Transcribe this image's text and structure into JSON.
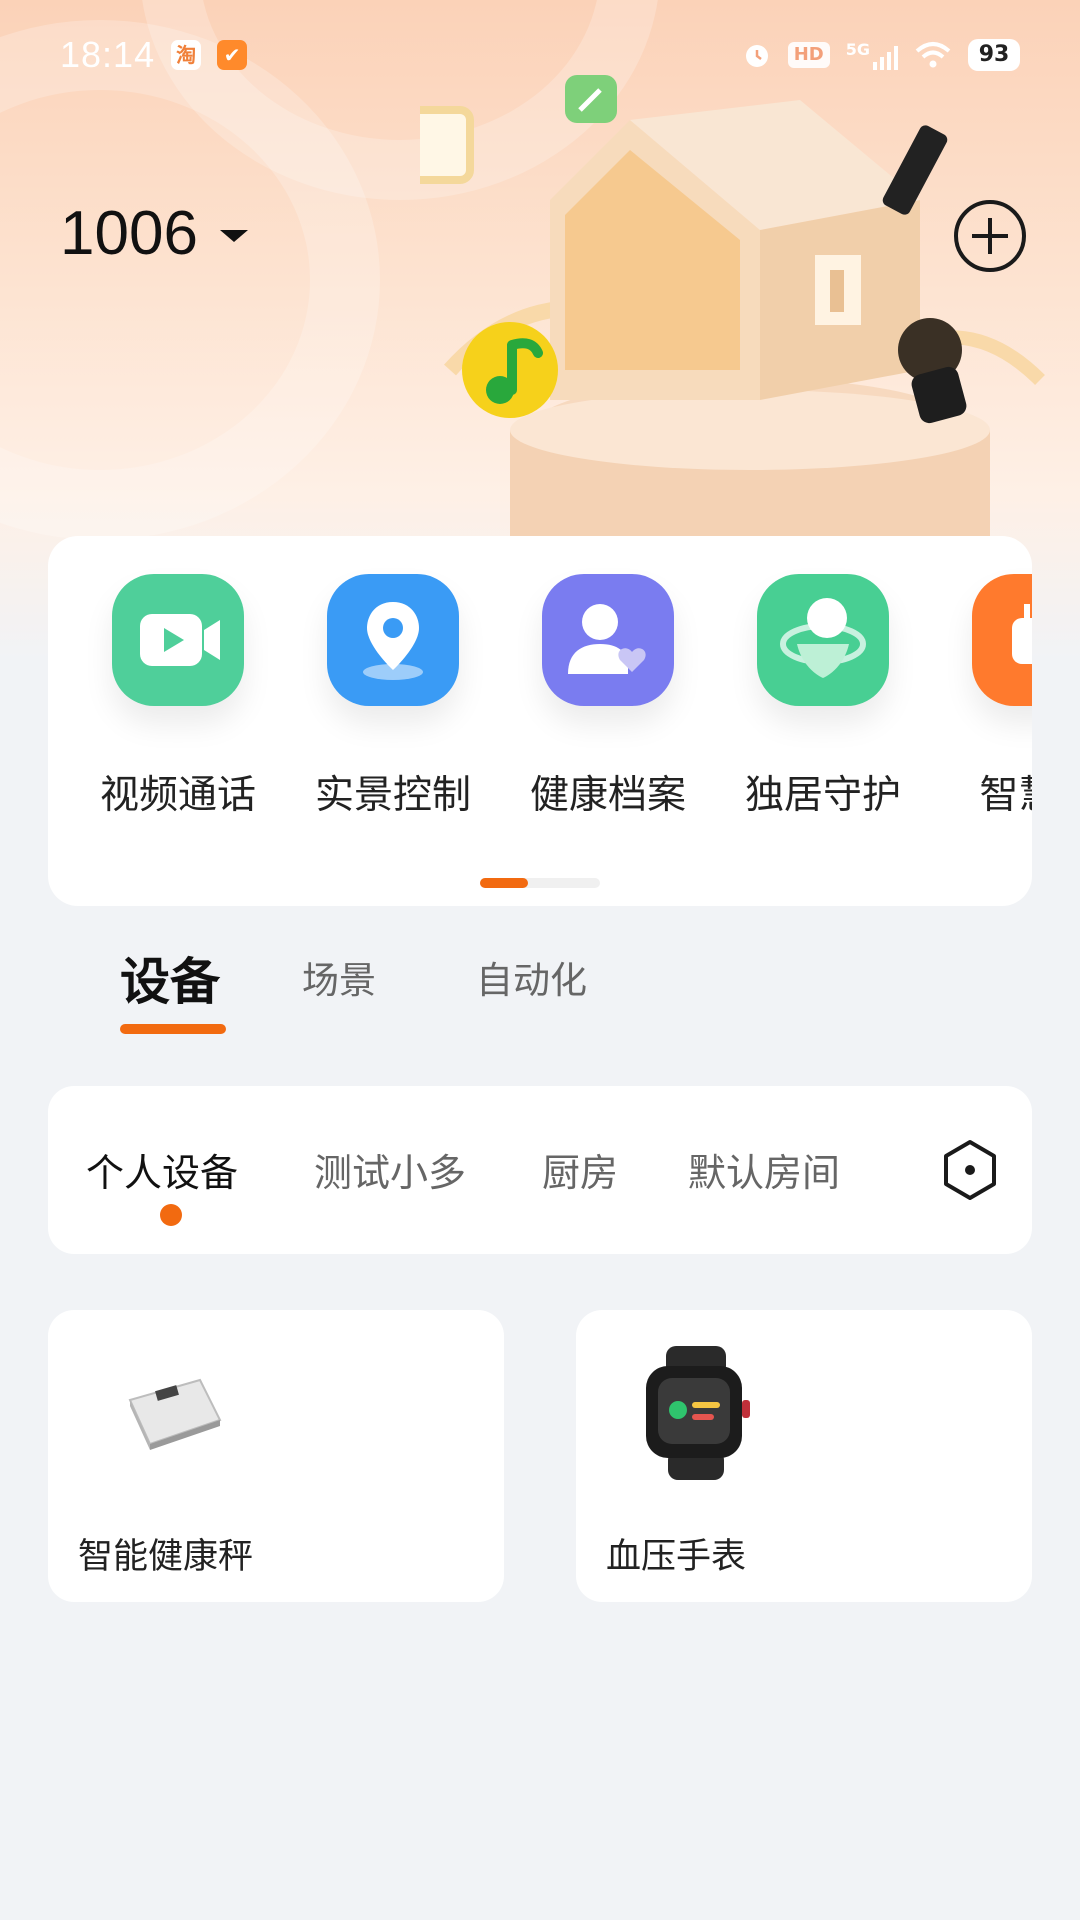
{
  "status_bar": {
    "time": "18:14",
    "app_icons": [
      "淘",
      "✔"
    ],
    "network": "5G",
    "hd_label": "HD",
    "battery": "93"
  },
  "header": {
    "home_name": "1006",
    "icons": [
      "chevron-down-icon",
      "add-icon"
    ]
  },
  "shortcuts": [
    {
      "label": "视频通话",
      "icon": "video-call-icon",
      "color": "#4fcf9a"
    },
    {
      "label": "实景控制",
      "icon": "location-pin-icon",
      "color": "#3a9bf5"
    },
    {
      "label": "健康档案",
      "icon": "health-profile-icon",
      "color": "#7a7cf0"
    },
    {
      "label": "独居守护",
      "icon": "guardian-icon",
      "color": "#48cf93"
    },
    {
      "label": "智慧月",
      "icon": "plug-icon",
      "color": "#ff7a2d"
    }
  ],
  "main_tabs": [
    {
      "label": "设备",
      "active": true
    },
    {
      "label": "场景",
      "active": false
    },
    {
      "label": "自动化",
      "active": false
    }
  ],
  "rooms": [
    {
      "label": "个人设备",
      "active": true
    },
    {
      "label": "测试小多",
      "active": false
    },
    {
      "label": "厨房",
      "active": false
    },
    {
      "label": "默认房间",
      "active": false
    }
  ],
  "devices": [
    {
      "name": "智能健康秤",
      "icon": "scale-icon"
    },
    {
      "name": "血压手表",
      "icon": "smartwatch-icon"
    }
  ],
  "colors": {
    "accent": "#f26a10",
    "background": "#f1f3f6",
    "hero_gradient_top": "#fbd2b8"
  }
}
